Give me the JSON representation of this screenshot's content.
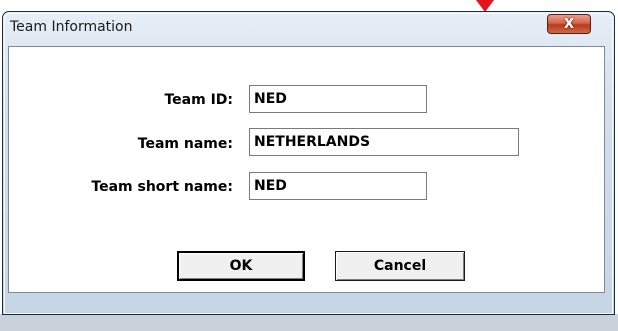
{
  "dialog": {
    "title": "Team Information",
    "close_symbol": "X"
  },
  "form": {
    "team_id": {
      "label": "Team ID:",
      "value": "NED"
    },
    "team_name": {
      "label": "Team name:",
      "value": "NETHERLANDS"
    },
    "team_short_name": {
      "label": "Team short name:",
      "value": "NED"
    }
  },
  "buttons": {
    "ok": "OK",
    "cancel": "Cancel"
  },
  "colors": {
    "marker": "#e3141c",
    "close_button": "#c04a2c"
  }
}
